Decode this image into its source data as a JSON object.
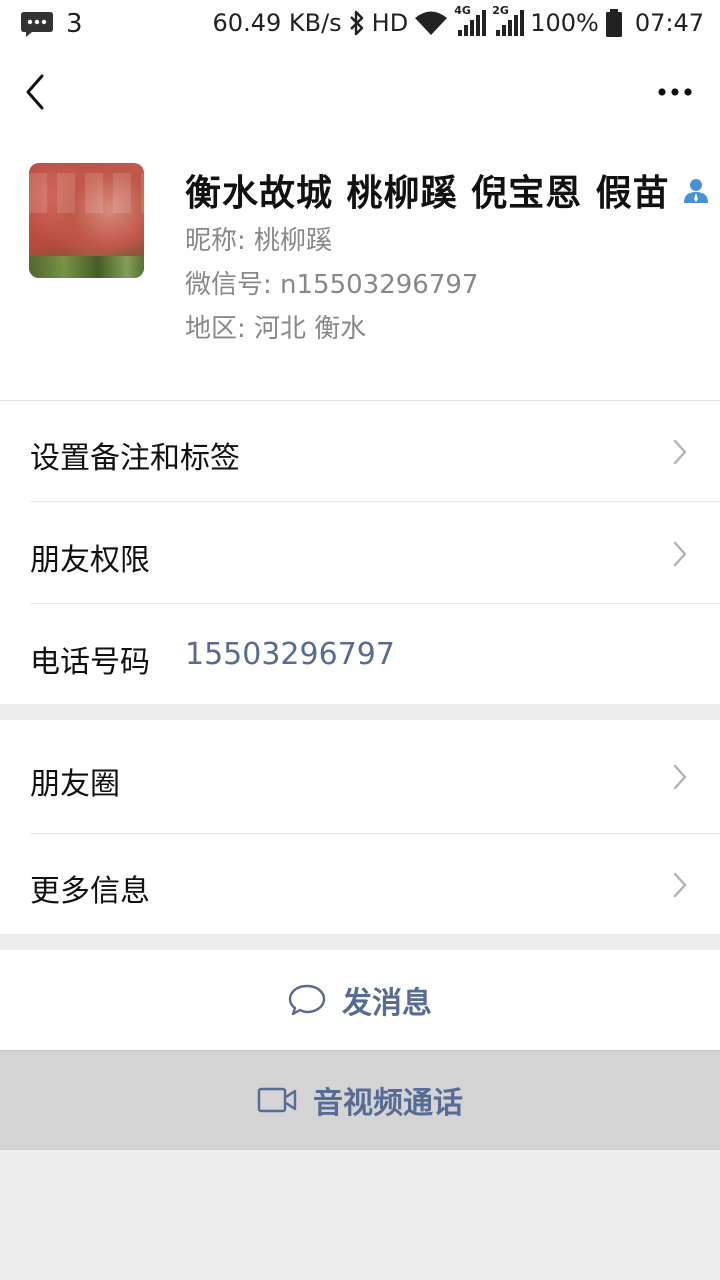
{
  "status_bar": {
    "notification_count": "3",
    "net_speed": "60.49 KB/s",
    "hd_label": "HD",
    "sig1_label": "4G",
    "sig2_label": "2G",
    "battery": "100%",
    "time": "07:47"
  },
  "profile": {
    "display_name": "衡水故城 桃柳蹊 倪宝恩 假苗",
    "nickname": "昵称:  桃柳蹊",
    "wechat_id": "微信号:  n15503296797",
    "region": "地区:  河北  衡水"
  },
  "settings_list": {
    "remark_tags": "设置备注和标签",
    "friend_permissions": "朋友权限",
    "phone_label": "电话号码",
    "phone_number": "15503296797"
  },
  "moments_list": {
    "moments": "朋友圈",
    "more_info": "更多信息"
  },
  "actions": {
    "send_message": "发消息",
    "video_call": "音视频通话"
  },
  "colors": {
    "link_blue": "#576b95",
    "icon_blue": "#4a90d9",
    "background": "#ededed"
  }
}
